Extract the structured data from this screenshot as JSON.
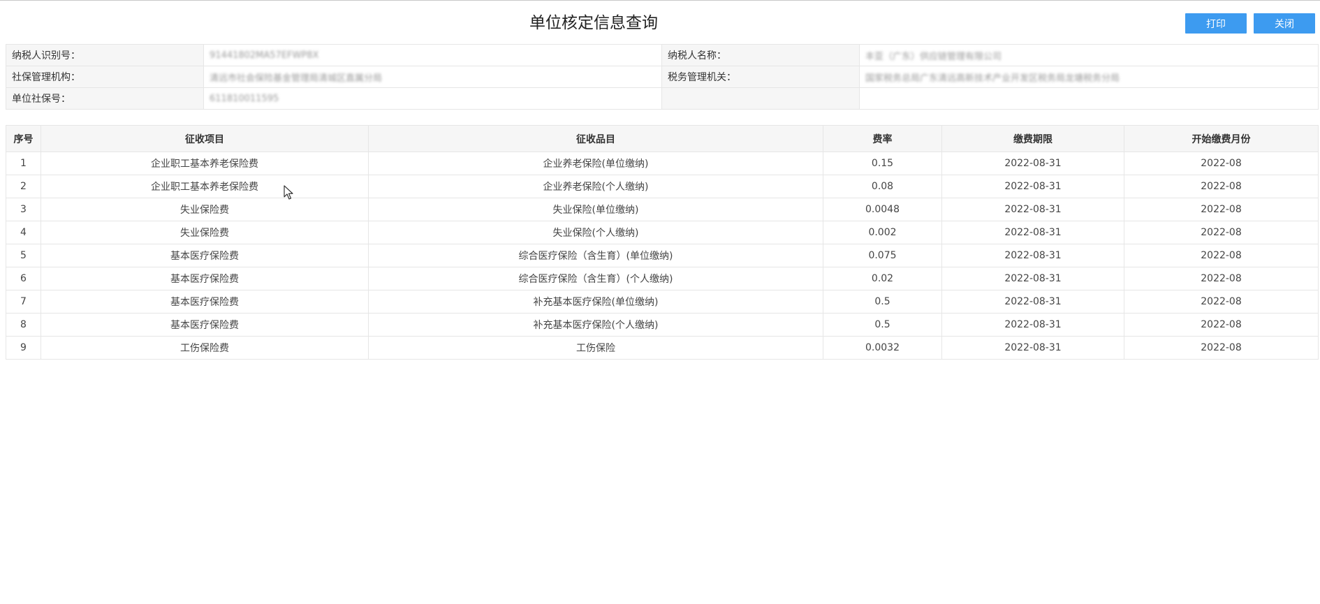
{
  "page": {
    "title": "单位核定信息查询"
  },
  "toolbar": {
    "print_label": "打印",
    "close_label": "关闭"
  },
  "info": {
    "taxpayer_id_label": "纳税人识别号：",
    "taxpayer_id_value": "91441802MA57EFWP8X",
    "taxpayer_name_label": "纳税人名称：",
    "taxpayer_name_value": "丰亚（广东）供应链管理有限公司",
    "social_agency_label": "社保管理机构：",
    "social_agency_value": "清远市社会保险基金管理局清城区直属分局",
    "tax_authority_label": "税务管理机关：",
    "tax_authority_value": "国家税务总局广东清远高新技术产业开发区税务局龙塘税务分局",
    "unit_ssn_label": "单位社保号：",
    "unit_ssn_value": "611810011595"
  },
  "table": {
    "headers": {
      "seq": "序号",
      "item": "征收项目",
      "subitem": "征收品目",
      "rate": "费率",
      "deadline": "缴费期限",
      "start_month": "开始缴费月份"
    },
    "rows": [
      {
        "seq": "1",
        "item": "企业职工基本养老保险费",
        "subitem": "企业养老保险(单位缴纳)",
        "rate": "0.15",
        "deadline": "2022-08-31",
        "start_month": "2022-08"
      },
      {
        "seq": "2",
        "item": "企业职工基本养老保险费",
        "subitem": "企业养老保险(个人缴纳)",
        "rate": "0.08",
        "deadline": "2022-08-31",
        "start_month": "2022-08"
      },
      {
        "seq": "3",
        "item": "失业保险费",
        "subitem": "失业保险(单位缴纳)",
        "rate": "0.0048",
        "deadline": "2022-08-31",
        "start_month": "2022-08"
      },
      {
        "seq": "4",
        "item": "失业保险费",
        "subitem": "失业保险(个人缴纳)",
        "rate": "0.002",
        "deadline": "2022-08-31",
        "start_month": "2022-08"
      },
      {
        "seq": "5",
        "item": "基本医疗保险费",
        "subitem": "综合医疗保险（含生育）(单位缴纳)",
        "rate": "0.075",
        "deadline": "2022-08-31",
        "start_month": "2022-08"
      },
      {
        "seq": "6",
        "item": "基本医疗保险费",
        "subitem": "综合医疗保险（含生育）(个人缴纳)",
        "rate": "0.02",
        "deadline": "2022-08-31",
        "start_month": "2022-08"
      },
      {
        "seq": "7",
        "item": "基本医疗保险费",
        "subitem": "补充基本医疗保险(单位缴纳)",
        "rate": "0.5",
        "deadline": "2022-08-31",
        "start_month": "2022-08"
      },
      {
        "seq": "8",
        "item": "基本医疗保险费",
        "subitem": "补充基本医疗保险(个人缴纳)",
        "rate": "0.5",
        "deadline": "2022-08-31",
        "start_month": "2022-08"
      },
      {
        "seq": "9",
        "item": "工伤保险费",
        "subitem": "工伤保险",
        "rate": "0.0032",
        "deadline": "2022-08-31",
        "start_month": "2022-08"
      }
    ]
  },
  "colors": {
    "accent": "#3d9bf0",
    "header_bg": "#f6f6f6",
    "border": "#e6e6e6"
  },
  "icons": {
    "cursor": "mouse-pointer-icon"
  }
}
